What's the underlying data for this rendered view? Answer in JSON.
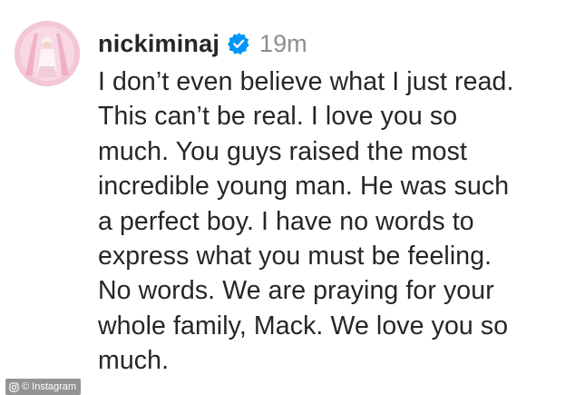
{
  "comment": {
    "avatar_icon": "profile-photo-avatar",
    "username": "nickiminaj",
    "verified_icon": "verified-badge-icon",
    "verified_color": "#0095f6",
    "timestamp": "19m",
    "text": "I don’t even believe what I just read.\nThis can’t be real. I love you so\nmuch. You guys raised the most\nincredible young man. He was such\na perfect boy. I have no words to\nexpress what you must be feeling.\nNo words. We are praying for your\nwhole family, Mack. We love you so\nmuch."
  },
  "watermark": {
    "icon": "camera-icon",
    "label": "© Instagram"
  }
}
